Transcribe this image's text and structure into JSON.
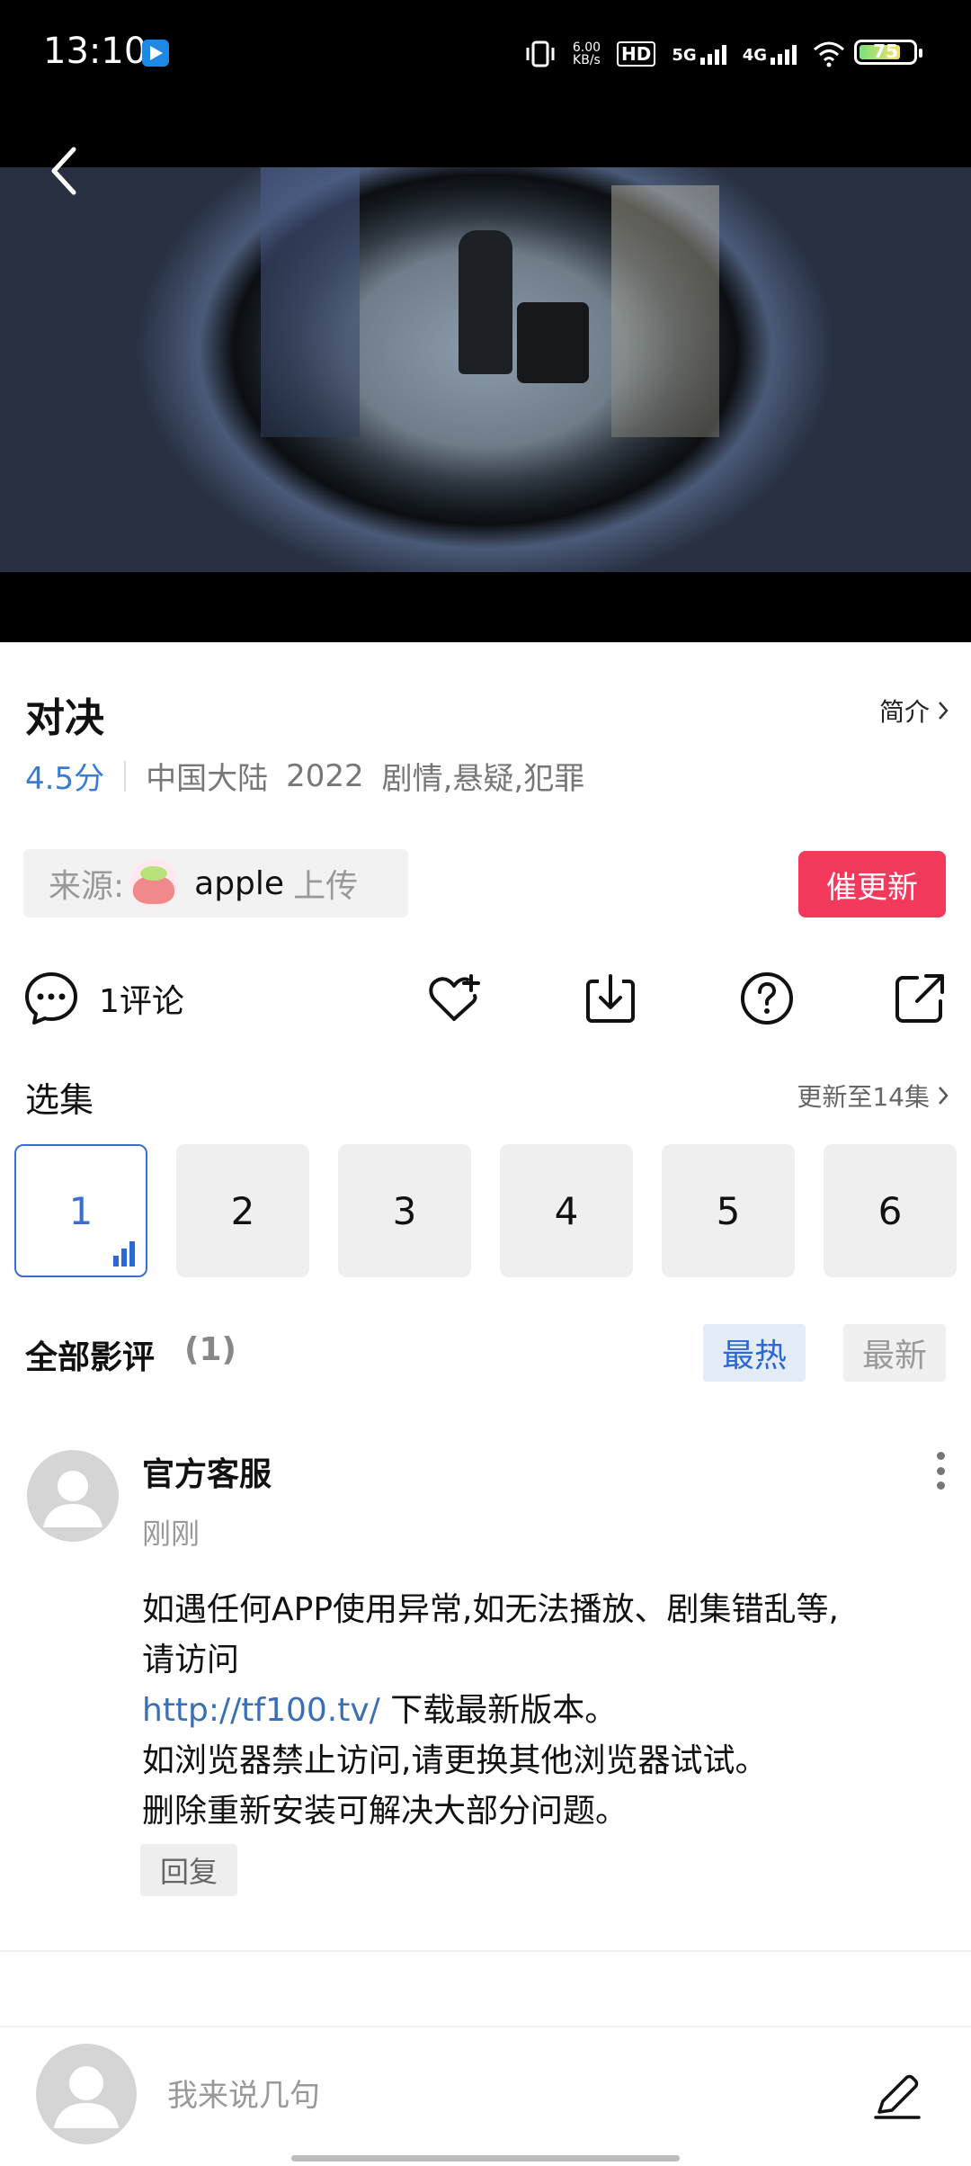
{
  "status_bar": {
    "time": "13:10",
    "net_speed_value": "6.00",
    "net_speed_unit": "KB/s",
    "hd_label": "HD",
    "sim1_net": "5G",
    "sim2_net": "4G",
    "battery_level": "75"
  },
  "video": {
    "back_icon": "chevron-left-icon"
  },
  "info": {
    "title": "对决",
    "intro_label": "简介",
    "score": "4.5分",
    "region": "中国大陆",
    "year": "2022",
    "genres": "剧情,悬疑,犯罪"
  },
  "source": {
    "label": "来源:",
    "uploader": "apple",
    "upload_label": "上传",
    "urge_button": "催更新"
  },
  "actions": {
    "comment_count": "1评论",
    "icons": [
      "comment-icon",
      "favorite-add-icon",
      "download-icon",
      "help-icon",
      "share-icon"
    ]
  },
  "episodes": {
    "title": "选集",
    "update_label": "更新至14集",
    "items": [
      "1",
      "2",
      "3",
      "4",
      "5",
      "6"
    ],
    "active_index": 0
  },
  "reviews": {
    "title": "全部影评",
    "count": "(1)",
    "tab_hot": "最热",
    "tab_new": "最新"
  },
  "comment": {
    "author": "官方客服",
    "time": "刚刚",
    "line1": "如遇任何APP使用异常,如无法播放、剧集错乱等,",
    "line2": "请访问",
    "link": "http://tf100.tv/",
    "line3_rest": " 下载最新版本。",
    "line4": "如浏览器禁止访问,请更换其他浏览器试试。",
    "line5": "删除重新安装可解决大部分问题。",
    "reply": "回复"
  },
  "bottom": {
    "placeholder": "我来说几句"
  }
}
